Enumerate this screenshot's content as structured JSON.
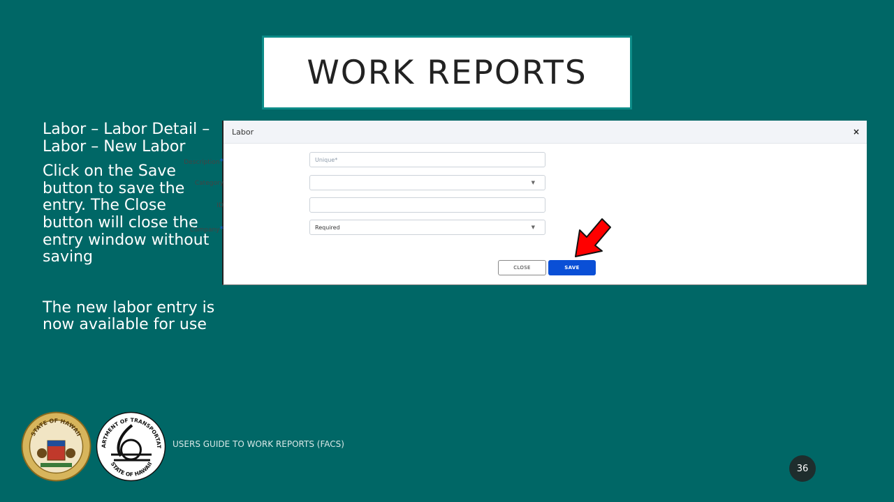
{
  "slide": {
    "title": "WORK REPORTS",
    "left_text": {
      "p1": "Labor – Labor Detail – Labor – New Labor",
      "p2": "Click on the Save button to save the entry.  The Close button will close the entry window without saving",
      "p3": "The new labor entry is now available for use"
    },
    "footer": "USERS GUIDE TO WORK REPORTS  (FACS)",
    "page_number": "36"
  },
  "dialog": {
    "title": "Labor",
    "close_icon": "×",
    "fields": {
      "description": {
        "label": "Description",
        "required_mark": "*",
        "placeholder": "Unique*",
        "value": ""
      },
      "category": {
        "label": "Category",
        "value": ""
      },
      "id": {
        "label": "ID",
        "value": ""
      },
      "company": {
        "label": "Company",
        "required_mark": "*",
        "value": "Required"
      }
    },
    "buttons": {
      "close": "CLOSE",
      "save": "SAVE"
    }
  },
  "logos": {
    "state_seal": "STATE OF HAWAII",
    "dot_seal_top": "DEPARTMENT OF TRANSPORTATION",
    "dot_seal_bottom": "STATE OF HAWAII"
  },
  "colors": {
    "background": "#006766",
    "title_border": "#0c8c88",
    "save_button": "#0a4fd6",
    "arrow": "#ff0000"
  }
}
